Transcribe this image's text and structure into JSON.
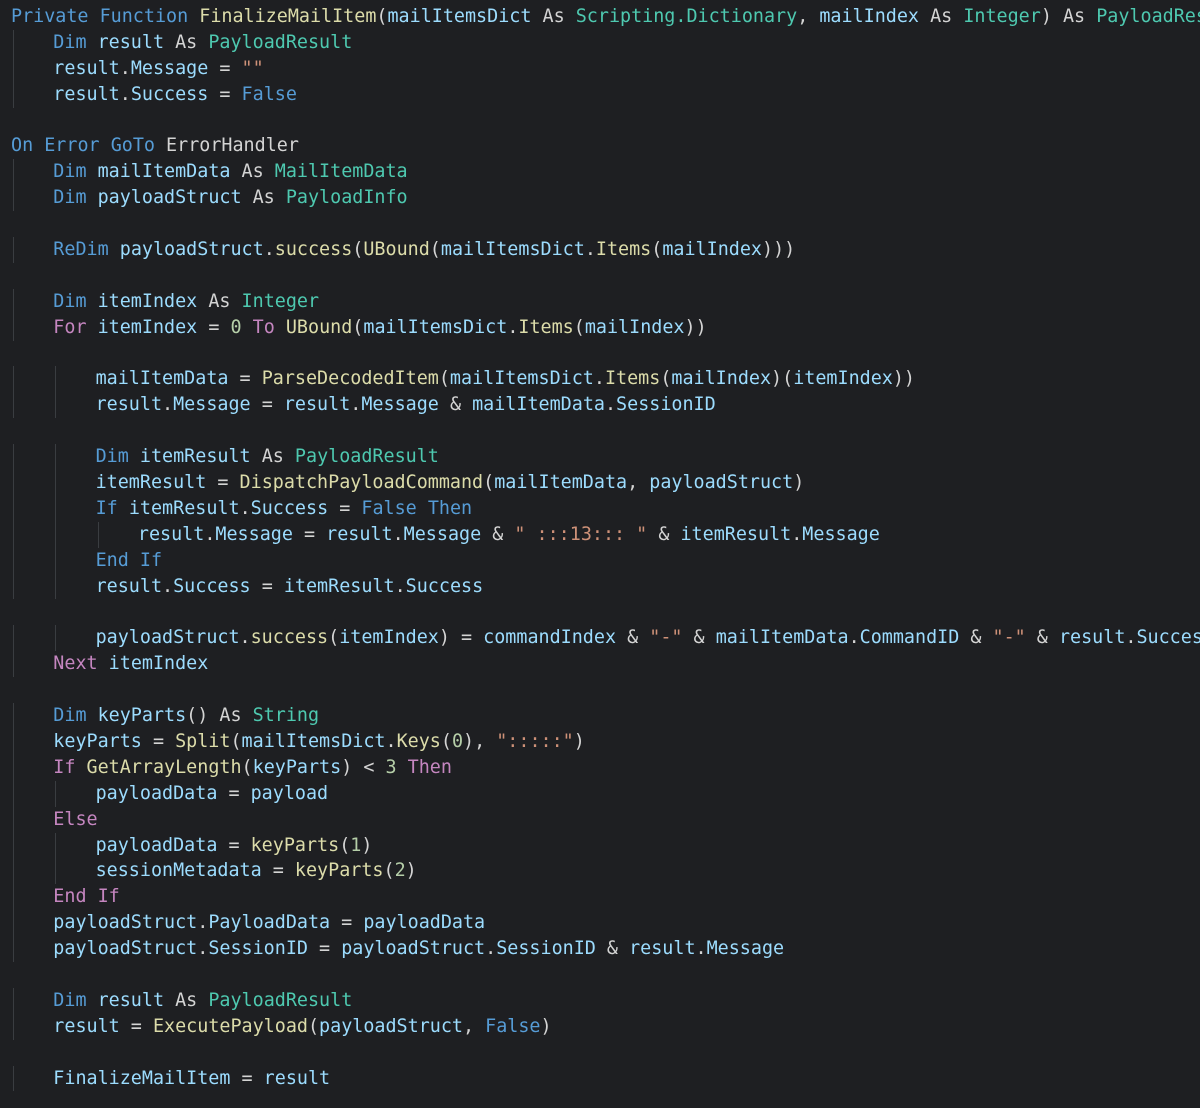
{
  "editor": {
    "language": "vba",
    "theme_colors": {
      "background": "#1e1f22",
      "keyword": "#569cd6",
      "control": "#c586c0",
      "type": "#4ec9b0",
      "function": "#dcdcaa",
      "variable": "#9cdcfe",
      "string": "#ce9178",
      "number": "#b5cea8",
      "plain": "#d4d4d4"
    },
    "lines": [
      {
        "indent": 0,
        "tokens": [
          [
            "kw",
            "Private"
          ],
          [
            "plain",
            " "
          ],
          [
            "kw",
            "Function"
          ],
          [
            "plain",
            " "
          ],
          [
            "fn",
            "FinalizeMailItem"
          ],
          [
            "plain",
            "("
          ],
          [
            "var",
            "mailItemsDict"
          ],
          [
            "plain",
            " "
          ],
          [
            "plain",
            "As"
          ],
          [
            "plain",
            " "
          ],
          [
            "type",
            "Scripting.Dictionary"
          ],
          [
            "plain",
            ", "
          ],
          [
            "var",
            "mailIndex"
          ],
          [
            "plain",
            " "
          ],
          [
            "plain",
            "As"
          ],
          [
            "plain",
            " "
          ],
          [
            "type",
            "Integer"
          ],
          [
            "plain",
            ") "
          ],
          [
            "plain",
            "As"
          ],
          [
            "plain",
            " "
          ],
          [
            "type",
            "PayloadResult"
          ]
        ]
      },
      {
        "indent": 1,
        "tokens": [
          [
            "kw",
            "Dim"
          ],
          [
            "plain",
            " "
          ],
          [
            "var",
            "result"
          ],
          [
            "plain",
            " As "
          ],
          [
            "type",
            "PayloadResult"
          ]
        ]
      },
      {
        "indent": 1,
        "tokens": [
          [
            "var",
            "result"
          ],
          [
            "plain",
            "."
          ],
          [
            "var",
            "Message"
          ],
          [
            "plain",
            " = "
          ],
          [
            "str",
            "\"\""
          ]
        ]
      },
      {
        "indent": 1,
        "tokens": [
          [
            "var",
            "result"
          ],
          [
            "plain",
            "."
          ],
          [
            "var",
            "Success"
          ],
          [
            "plain",
            " = "
          ],
          [
            "kw",
            "False"
          ]
        ]
      },
      {
        "indent": 0,
        "tokens": []
      },
      {
        "indent": 0,
        "tokens": [
          [
            "kw",
            "On"
          ],
          [
            "plain",
            " "
          ],
          [
            "kw",
            "Error"
          ],
          [
            "plain",
            " "
          ],
          [
            "kw",
            "GoTo"
          ],
          [
            "plain",
            " ErrorHandler"
          ]
        ]
      },
      {
        "indent": 1,
        "tokens": [
          [
            "kw",
            "Dim"
          ],
          [
            "plain",
            " "
          ],
          [
            "var",
            "mailItemData"
          ],
          [
            "plain",
            " As "
          ],
          [
            "type",
            "MailItemData"
          ]
        ]
      },
      {
        "indent": 1,
        "tokens": [
          [
            "kw",
            "Dim"
          ],
          [
            "plain",
            " "
          ],
          [
            "var",
            "payloadStruct"
          ],
          [
            "plain",
            " As "
          ],
          [
            "type",
            "PayloadInfo"
          ]
        ]
      },
      {
        "indent": 0,
        "tokens": []
      },
      {
        "indent": 1,
        "tokens": [
          [
            "kw",
            "ReDim"
          ],
          [
            "plain",
            " "
          ],
          [
            "var",
            "payloadStruct"
          ],
          [
            "plain",
            "."
          ],
          [
            "fn",
            "success"
          ],
          [
            "plain",
            "("
          ],
          [
            "fn",
            "UBound"
          ],
          [
            "plain",
            "("
          ],
          [
            "var",
            "mailItemsDict"
          ],
          [
            "plain",
            "."
          ],
          [
            "fn",
            "Items"
          ],
          [
            "plain",
            "("
          ],
          [
            "var",
            "mailIndex"
          ],
          [
            "plain",
            ")))"
          ]
        ]
      },
      {
        "indent": 0,
        "tokens": []
      },
      {
        "indent": 1,
        "tokens": [
          [
            "kw",
            "Dim"
          ],
          [
            "plain",
            " "
          ],
          [
            "var",
            "itemIndex"
          ],
          [
            "plain",
            " As "
          ],
          [
            "type",
            "Integer"
          ]
        ]
      },
      {
        "indent": 1,
        "tokens": [
          [
            "ctl",
            "For"
          ],
          [
            "plain",
            " "
          ],
          [
            "var",
            "itemIndex"
          ],
          [
            "plain",
            " = "
          ],
          [
            "num",
            "0"
          ],
          [
            "plain",
            " "
          ],
          [
            "ctl",
            "To"
          ],
          [
            "plain",
            " "
          ],
          [
            "fn",
            "UBound"
          ],
          [
            "plain",
            "("
          ],
          [
            "var",
            "mailItemsDict"
          ],
          [
            "plain",
            "."
          ],
          [
            "fn",
            "Items"
          ],
          [
            "plain",
            "("
          ],
          [
            "var",
            "mailIndex"
          ],
          [
            "plain",
            "))"
          ]
        ]
      },
      {
        "indent": 0,
        "tokens": []
      },
      {
        "indent": 2,
        "tokens": [
          [
            "var",
            "mailItemData"
          ],
          [
            "plain",
            " = "
          ],
          [
            "fn",
            "ParseDecodedItem"
          ],
          [
            "plain",
            "("
          ],
          [
            "var",
            "mailItemsDict"
          ],
          [
            "plain",
            "."
          ],
          [
            "fn",
            "Items"
          ],
          [
            "plain",
            "("
          ],
          [
            "var",
            "mailIndex"
          ],
          [
            "plain",
            ")("
          ],
          [
            "var",
            "itemIndex"
          ],
          [
            "plain",
            "))"
          ]
        ]
      },
      {
        "indent": 2,
        "tokens": [
          [
            "var",
            "result"
          ],
          [
            "plain",
            "."
          ],
          [
            "var",
            "Message"
          ],
          [
            "plain",
            " = "
          ],
          [
            "var",
            "result"
          ],
          [
            "plain",
            "."
          ],
          [
            "var",
            "Message"
          ],
          [
            "plain",
            " & "
          ],
          [
            "var",
            "mailItemData"
          ],
          [
            "plain",
            "."
          ],
          [
            "var",
            "SessionID"
          ]
        ]
      },
      {
        "indent": 0,
        "tokens": []
      },
      {
        "indent": 2,
        "tokens": [
          [
            "kw",
            "Dim"
          ],
          [
            "plain",
            " "
          ],
          [
            "var",
            "itemResult"
          ],
          [
            "plain",
            " As "
          ],
          [
            "type",
            "PayloadResult"
          ]
        ]
      },
      {
        "indent": 2,
        "tokens": [
          [
            "var",
            "itemResult"
          ],
          [
            "plain",
            " = "
          ],
          [
            "fn",
            "DispatchPayloadCommand"
          ],
          [
            "plain",
            "("
          ],
          [
            "var",
            "mailItemData"
          ],
          [
            "plain",
            ", "
          ],
          [
            "var",
            "payloadStruct"
          ],
          [
            "plain",
            ")"
          ]
        ]
      },
      {
        "indent": 2,
        "tokens": [
          [
            "kw",
            "If"
          ],
          [
            "plain",
            " "
          ],
          [
            "var",
            "itemResult"
          ],
          [
            "plain",
            "."
          ],
          [
            "var",
            "Success"
          ],
          [
            "plain",
            " = "
          ],
          [
            "kw",
            "False"
          ],
          [
            "plain",
            " "
          ],
          [
            "kw",
            "Then"
          ]
        ]
      },
      {
        "indent": 3,
        "tokens": [
          [
            "var",
            "result"
          ],
          [
            "plain",
            "."
          ],
          [
            "var",
            "Message"
          ],
          [
            "plain",
            " = "
          ],
          [
            "var",
            "result"
          ],
          [
            "plain",
            "."
          ],
          [
            "var",
            "Message"
          ],
          [
            "plain",
            " & "
          ],
          [
            "str",
            "\" :::13::: \""
          ],
          [
            "plain",
            " & "
          ],
          [
            "var",
            "itemResult"
          ],
          [
            "plain",
            "."
          ],
          [
            "var",
            "Message"
          ]
        ]
      },
      {
        "indent": 2,
        "tokens": [
          [
            "kw",
            "End"
          ],
          [
            "plain",
            " "
          ],
          [
            "kw",
            "If"
          ]
        ]
      },
      {
        "indent": 2,
        "tokens": [
          [
            "var",
            "result"
          ],
          [
            "plain",
            "."
          ],
          [
            "var",
            "Success"
          ],
          [
            "plain",
            " = "
          ],
          [
            "var",
            "itemResult"
          ],
          [
            "plain",
            "."
          ],
          [
            "var",
            "Success"
          ]
        ]
      },
      {
        "indent": 0,
        "tokens": []
      },
      {
        "indent": 2,
        "tokens": [
          [
            "var",
            "payloadStruct"
          ],
          [
            "plain",
            "."
          ],
          [
            "fn",
            "success"
          ],
          [
            "plain",
            "("
          ],
          [
            "var",
            "itemIndex"
          ],
          [
            "plain",
            ") = "
          ],
          [
            "var",
            "commandIndex"
          ],
          [
            "plain",
            " & "
          ],
          [
            "str",
            "\"-\""
          ],
          [
            "plain",
            " & "
          ],
          [
            "var",
            "mailItemData"
          ],
          [
            "plain",
            "."
          ],
          [
            "var",
            "CommandID"
          ],
          [
            "plain",
            " & "
          ],
          [
            "str",
            "\"-\""
          ],
          [
            "plain",
            " & "
          ],
          [
            "var",
            "result"
          ],
          [
            "plain",
            "."
          ],
          [
            "var",
            "Success"
          ]
        ]
      },
      {
        "indent": 1,
        "tokens": [
          [
            "ctl",
            "Next"
          ],
          [
            "plain",
            " "
          ],
          [
            "var",
            "itemIndex"
          ]
        ]
      },
      {
        "indent": 0,
        "tokens": []
      },
      {
        "indent": 1,
        "tokens": [
          [
            "kw",
            "Dim"
          ],
          [
            "plain",
            " "
          ],
          [
            "var",
            "keyParts"
          ],
          [
            "plain",
            "() As "
          ],
          [
            "type",
            "String"
          ]
        ]
      },
      {
        "indent": 1,
        "tokens": [
          [
            "var",
            "keyParts"
          ],
          [
            "plain",
            " = "
          ],
          [
            "fn",
            "Split"
          ],
          [
            "plain",
            "("
          ],
          [
            "var",
            "mailItemsDict"
          ],
          [
            "plain",
            "."
          ],
          [
            "fn",
            "Keys"
          ],
          [
            "plain",
            "("
          ],
          [
            "num",
            "0"
          ],
          [
            "plain",
            "), "
          ],
          [
            "str",
            "\":::::\""
          ],
          [
            "plain",
            ")"
          ]
        ]
      },
      {
        "indent": 1,
        "tokens": [
          [
            "ctl",
            "If"
          ],
          [
            "plain",
            " "
          ],
          [
            "fn",
            "GetArrayLength"
          ],
          [
            "plain",
            "("
          ],
          [
            "var",
            "keyParts"
          ],
          [
            "plain",
            ") < "
          ],
          [
            "num",
            "3"
          ],
          [
            "plain",
            " "
          ],
          [
            "ctl",
            "Then"
          ]
        ]
      },
      {
        "indent": 2,
        "tokens": [
          [
            "var",
            "payloadData"
          ],
          [
            "plain",
            " = "
          ],
          [
            "var",
            "payload"
          ]
        ]
      },
      {
        "indent": 1,
        "tokens": [
          [
            "ctl",
            "Else"
          ]
        ]
      },
      {
        "indent": 2,
        "tokens": [
          [
            "var",
            "payloadData"
          ],
          [
            "plain",
            " = "
          ],
          [
            "fn",
            "keyParts"
          ],
          [
            "plain",
            "("
          ],
          [
            "num",
            "1"
          ],
          [
            "plain",
            ")"
          ]
        ]
      },
      {
        "indent": 2,
        "tokens": [
          [
            "var",
            "sessionMetadata"
          ],
          [
            "plain",
            " = "
          ],
          [
            "fn",
            "keyParts"
          ],
          [
            "plain",
            "("
          ],
          [
            "num",
            "2"
          ],
          [
            "plain",
            ")"
          ]
        ]
      },
      {
        "indent": 1,
        "tokens": [
          [
            "ctl",
            "End"
          ],
          [
            "plain",
            " "
          ],
          [
            "ctl",
            "If"
          ]
        ]
      },
      {
        "indent": 1,
        "tokens": [
          [
            "var",
            "payloadStruct"
          ],
          [
            "plain",
            "."
          ],
          [
            "var",
            "PayloadData"
          ],
          [
            "plain",
            " = "
          ],
          [
            "var",
            "payloadData"
          ]
        ]
      },
      {
        "indent": 1,
        "tokens": [
          [
            "var",
            "payloadStruct"
          ],
          [
            "plain",
            "."
          ],
          [
            "var",
            "SessionID"
          ],
          [
            "plain",
            " = "
          ],
          [
            "var",
            "payloadStruct"
          ],
          [
            "plain",
            "."
          ],
          [
            "var",
            "SessionID"
          ],
          [
            "plain",
            " & "
          ],
          [
            "var",
            "result"
          ],
          [
            "plain",
            "."
          ],
          [
            "var",
            "Message"
          ]
        ]
      },
      {
        "indent": 0,
        "tokens": []
      },
      {
        "indent": 1,
        "tokens": [
          [
            "kw",
            "Dim"
          ],
          [
            "plain",
            " "
          ],
          [
            "var",
            "result"
          ],
          [
            "plain",
            " As "
          ],
          [
            "type",
            "PayloadResult"
          ]
        ]
      },
      {
        "indent": 1,
        "tokens": [
          [
            "var",
            "result"
          ],
          [
            "plain",
            " = "
          ],
          [
            "fn",
            "ExecutePayload"
          ],
          [
            "plain",
            "("
          ],
          [
            "var",
            "payloadStruct"
          ],
          [
            "plain",
            ", "
          ],
          [
            "kw",
            "False"
          ],
          [
            "plain",
            ")"
          ]
        ]
      },
      {
        "indent": 0,
        "tokens": []
      },
      {
        "indent": 1,
        "tokens": [
          [
            "var",
            "FinalizeMailItem"
          ],
          [
            "plain",
            " = "
          ],
          [
            "var",
            "result"
          ]
        ]
      }
    ]
  }
}
